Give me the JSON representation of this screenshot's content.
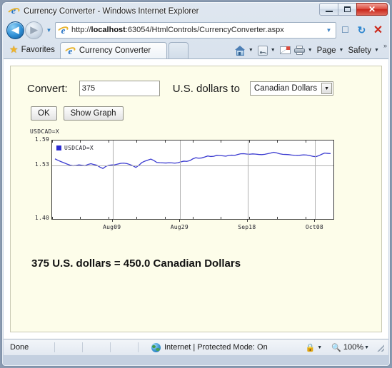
{
  "window": {
    "title": "Currency Converter - Windows Internet Explorer",
    "minimize_label": "Minimize",
    "maximize_label": "Maximize",
    "close_label": "✕"
  },
  "address_bar": {
    "url_scheme": "http://",
    "url_host_bold": "localhost",
    "url_rest": ":63054/HtmlControls/CurrencyConverter.aspx",
    "full_url": "http://localhost:63054/HtmlControls/CurrencyConverter.aspx",
    "dropdown_icon": "chevron-down-icon",
    "compat_icon": "compatibility-view-icon",
    "refresh_icon": "↻",
    "stop_icon": "✕",
    "back_icon": "◀",
    "forward_icon": "▶",
    "recent_pages_icon": "▼"
  },
  "tabbar": {
    "favorites_label": "Favorites",
    "star_icon": "★",
    "tabs": [
      {
        "label": "Currency Converter",
        "active": true
      }
    ],
    "new_tab_label": "",
    "commands": [
      {
        "name": "home",
        "label": "",
        "icon": "home-icon",
        "has_caret": true
      },
      {
        "name": "feeds",
        "label": "",
        "icon": "feed-icon",
        "has_caret": true
      },
      {
        "name": "mail",
        "label": "",
        "icon": "mail-icon",
        "has_caret": false
      },
      {
        "name": "print",
        "label": "",
        "icon": "printer-icon",
        "has_caret": true
      },
      {
        "name": "page",
        "label": "Page",
        "icon": "",
        "has_caret": true
      },
      {
        "name": "safety",
        "label": "Safety",
        "icon": "",
        "has_caret": true
      }
    ],
    "overflow_label": "»",
    "caret_glyph": "▼"
  },
  "form": {
    "convert_label": "Convert:",
    "amount_value": "375",
    "amount_placeholder": "",
    "middle_label": "U.S. dollars to",
    "currency_selected": "Canadian Dollars",
    "currency_options": [
      "Canadian Dollars"
    ],
    "select_arrow": "▼",
    "ok_label": "OK",
    "show_graph_label": "Show Graph"
  },
  "result": {
    "text": "375 U.S. dollars = 450.0 Canadian Dollars"
  },
  "chart_data": {
    "type": "line",
    "title": "USDCAD=X",
    "xlabel": "",
    "ylabel": "",
    "legend": [
      "USDCAD=X"
    ],
    "legend_position": "top-left-inside",
    "series_color": "#3a3ad0",
    "grid": true,
    "ylim": [
      1.4,
      1.59
    ],
    "yticks": [
      1.4,
      1.53,
      1.59
    ],
    "ytick_labels": [
      "1.40",
      "1.53",
      "1.59"
    ],
    "gridlines_y": [
      1.53
    ],
    "xtick_labels": [
      "Aug09",
      "Aug29",
      "Sep18",
      "Oct08"
    ],
    "xtick_positions": [
      0.215,
      0.455,
      0.695,
      0.935
    ],
    "gridlines_x": [
      0.215,
      0.455,
      0.695,
      0.935
    ],
    "series": [
      {
        "name": "USDCAD=X",
        "values": [
          1.5455,
          1.542,
          1.5388,
          1.536,
          1.533,
          1.5305,
          1.5288,
          1.5295,
          1.531,
          1.53,
          1.5288,
          1.532,
          1.5338,
          1.5318,
          1.53,
          1.5255,
          1.5222,
          1.5275,
          1.53,
          1.5308,
          1.5312,
          1.533,
          1.5348,
          1.5352,
          1.534,
          1.5318,
          1.5288,
          1.5248,
          1.53,
          1.5365,
          1.54,
          1.5425,
          1.545,
          1.5415,
          1.5368,
          1.5362,
          1.5358,
          1.5355,
          1.536,
          1.5358,
          1.5352,
          1.536,
          1.5382,
          1.54,
          1.5395,
          1.5412,
          1.5455,
          1.5482,
          1.547,
          1.5478,
          1.55,
          1.5525,
          1.5512,
          1.5518,
          1.554,
          1.5535,
          1.5528,
          1.552,
          1.5538,
          1.5545,
          1.554,
          1.5562,
          1.5578,
          1.558,
          1.5572,
          1.5568,
          1.5575,
          1.557,
          1.5562,
          1.5558,
          1.5565,
          1.558,
          1.5595,
          1.5615,
          1.56,
          1.5578,
          1.5565,
          1.5562,
          1.5558,
          1.5548,
          1.5542,
          1.5538,
          1.5545,
          1.5552,
          1.5548,
          1.5535,
          1.5518,
          1.5508,
          1.553,
          1.5565,
          1.5595,
          1.5588,
          1.5582
        ]
      }
    ]
  },
  "statusbar": {
    "status_text": "Done",
    "zone_text": "Internet | Protected Mode: On",
    "globe_icon": "internet-zone-icon",
    "privacy_icon": "privacy-report-icon",
    "zoom_value": "100%",
    "zoom_icon": "zoom-icon",
    "caret_glyph": "▼"
  }
}
